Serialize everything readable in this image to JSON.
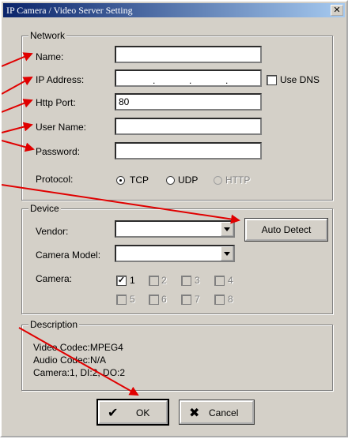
{
  "window": {
    "title": "IP Camera / Video Server Setting",
    "close_glyph": "✕"
  },
  "network": {
    "legend": "Network",
    "name_label": "Name:",
    "name_value": "",
    "ip_label": "IP Address:",
    "ip_values": [
      "",
      "",
      "",
      ""
    ],
    "ip_dots": [
      ".",
      ".",
      "."
    ],
    "use_dns_label": "Use DNS",
    "use_dns_checked": false,
    "http_port_label": "Http Port:",
    "http_port_value": "80",
    "user_name_label": "User Name:",
    "user_name_value": "",
    "password_label": "Password:",
    "password_value": "",
    "protocol_label": "Protocol:",
    "protocol_options": [
      "TCP",
      "UDP",
      "HTTP"
    ],
    "protocol_selected": "TCP"
  },
  "device": {
    "legend": "Device",
    "vendor_label": "Vendor:",
    "vendor_value": "",
    "auto_detect_label": "Auto Detect",
    "camera_model_label": "Camera Model:",
    "camera_model_value": "",
    "camera_label": "Camera:",
    "cameras": [
      {
        "label": "1",
        "checked": true,
        "enabled": true
      },
      {
        "label": "2",
        "checked": false,
        "enabled": false
      },
      {
        "label": "3",
        "checked": false,
        "enabled": false
      },
      {
        "label": "4",
        "checked": false,
        "enabled": false
      },
      {
        "label": "5",
        "checked": false,
        "enabled": false
      },
      {
        "label": "6",
        "checked": false,
        "enabled": false
      },
      {
        "label": "7",
        "checked": false,
        "enabled": false
      },
      {
        "label": "8",
        "checked": false,
        "enabled": false
      }
    ]
  },
  "description": {
    "legend": "Description",
    "lines": [
      "Video Codec:MPEG4",
      "Audio Codec:N/A",
      "Camera:1, DI:2, DO:2"
    ]
  },
  "buttons": {
    "ok_label": "OK",
    "cancel_label": "Cancel",
    "ok_glyph": "✔",
    "cancel_glyph": "✖"
  },
  "colors": {
    "annotation_arrow": "#e00000",
    "titlebar_start": "#0a246a",
    "titlebar_end": "#a6caf0"
  }
}
